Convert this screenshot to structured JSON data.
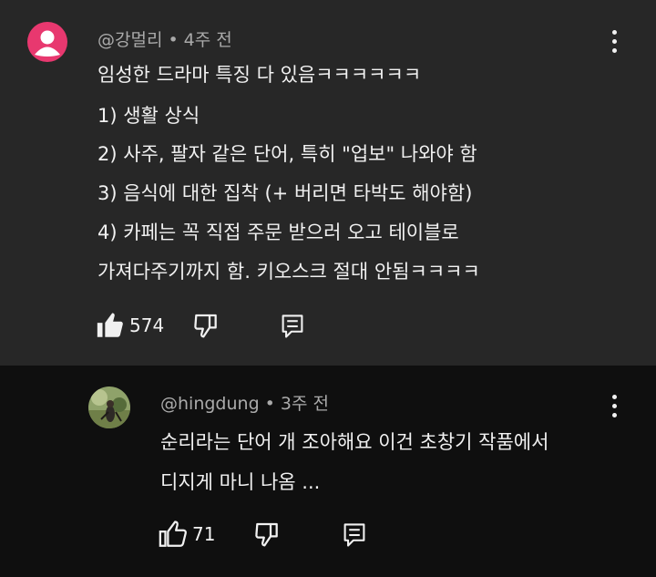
{
  "comments": [
    {
      "author": "@강멀리",
      "time": "4주 전",
      "lines": [
        "임성한 드라마 특징 다 있음ㅋㅋㅋㅋㅋㅋ",
        "1) 생활 상식",
        "2) 사주, 팔자 같은 단어, 특히 \"업보\" 나와야 함",
        "3) 음식에 대한 집착 (+ 버리면 타박도 해야함)",
        "4) 카페는 꼭 직접 주문 받으러 오고 테이블로",
        "가져다주기까지 함. 키오스크 절대 안됨ㅋㅋㅋㅋ"
      ],
      "likes": "574",
      "like_icon": "thumb-up-filled-icon",
      "avatar_color": "#e8386f"
    },
    {
      "author": "@hingdung",
      "time": "3주 전",
      "lines": [
        "순리라는 단어 개 조아해요 이건 초창기 작품에서",
        "디지게 마니 나옴 ..."
      ],
      "likes": "71",
      "like_icon": "thumb-up-outline-icon"
    }
  ],
  "colors": {
    "top_bg": "#272727",
    "reply_bg": "#0f0f0f",
    "text": "#f1f1f1",
    "meta": "#aaaaaa"
  }
}
